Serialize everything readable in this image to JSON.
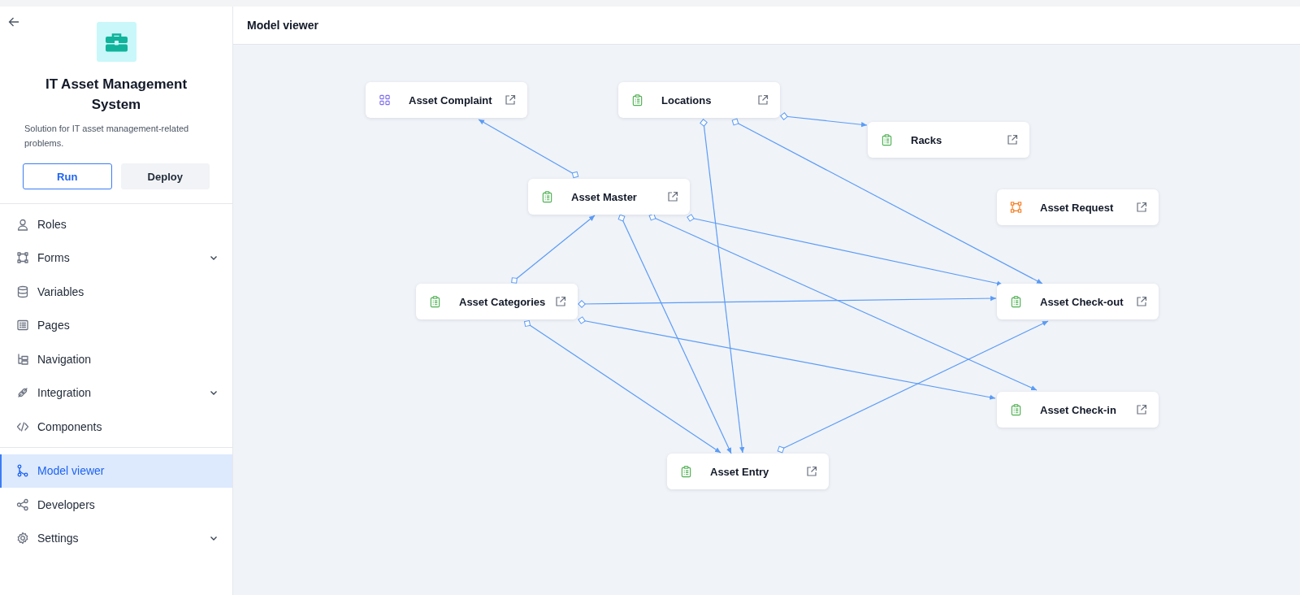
{
  "app": {
    "title": "IT Asset Management System",
    "description": "Solution for IT asset management-related problems.",
    "buttons": [
      {
        "label": "Run",
        "kind": "primary"
      },
      {
        "label": "Deploy",
        "kind": "secondary"
      }
    ]
  },
  "nav": {
    "groups": [
      {
        "items": [
          {
            "label": "Roles",
            "expandable": false,
            "selected": false
          },
          {
            "label": "Forms",
            "expandable": true,
            "selected": false
          },
          {
            "label": "Variables",
            "expandable": false,
            "selected": false
          },
          {
            "label": "Pages",
            "expandable": false,
            "selected": false
          },
          {
            "label": "Navigation",
            "expandable": false,
            "selected": false
          },
          {
            "label": "Integration",
            "expandable": true,
            "selected": false
          },
          {
            "label": "Components",
            "expandable": false,
            "selected": false
          }
        ]
      },
      {
        "items": [
          {
            "label": "Model viewer",
            "expandable": false,
            "selected": true
          },
          {
            "label": "Developers",
            "expandable": false,
            "selected": false
          },
          {
            "label": "Settings",
            "expandable": true,
            "selected": false
          }
        ]
      }
    ]
  },
  "page_title": "Model viewer",
  "model": {
    "nodes": [
      {
        "label": "Asset Complaint",
        "kind": "grid"
      },
      {
        "label": "Locations",
        "kind": "form"
      },
      {
        "label": "Racks",
        "kind": "form"
      },
      {
        "label": "Asset Master",
        "kind": "form"
      },
      {
        "label": "Asset Request",
        "kind": "process"
      },
      {
        "label": "Asset Categories",
        "kind": "form"
      },
      {
        "label": "Asset Check-out",
        "kind": "form"
      },
      {
        "label": "Asset Check-in",
        "kind": "form"
      },
      {
        "label": "Asset Entry",
        "kind": "form"
      }
    ]
  }
}
